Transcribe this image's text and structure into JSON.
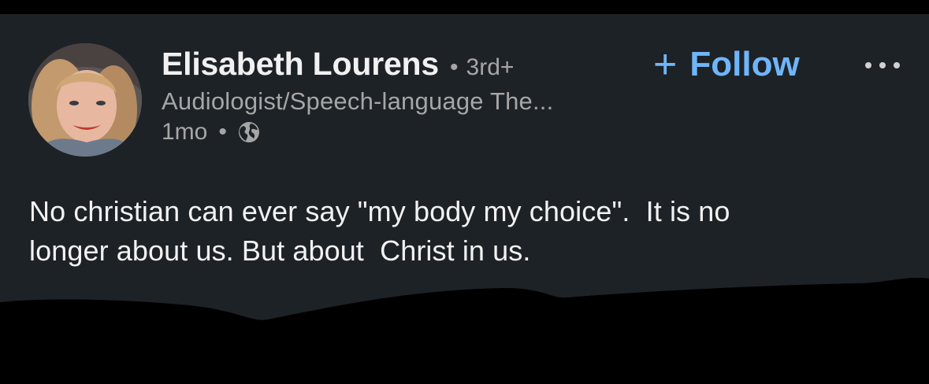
{
  "post": {
    "author": {
      "name": "Elisabeth Lourens",
      "separator": "•",
      "degree": "3rd+",
      "headline": "Audiologist/Speech-language The...",
      "time": "1mo",
      "time_separator": "•",
      "visibility_icon": "globe-icon"
    },
    "follow": {
      "icon": "plus-icon",
      "label": "Follow"
    },
    "more_icon": "more-options-icon",
    "text": "No christian can ever say \"my body my choice\".  It is no\nlonger about us. But about  Christ in us."
  },
  "colors": {
    "background": "#1d2226",
    "accent": "#70b5f9",
    "secondary_text": "#a6a6a6",
    "redaction": "#000000"
  }
}
